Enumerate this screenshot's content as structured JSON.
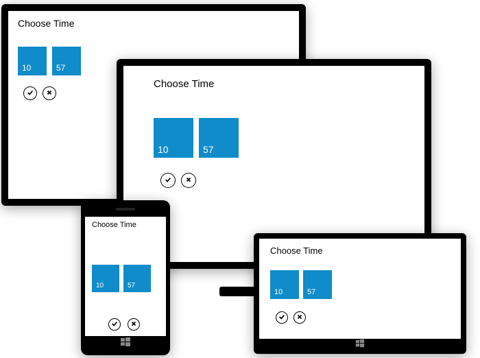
{
  "title": "Choose Time",
  "time": {
    "hour": "10",
    "minute": "57"
  },
  "colors": {
    "tile": "#0f8cc9"
  }
}
